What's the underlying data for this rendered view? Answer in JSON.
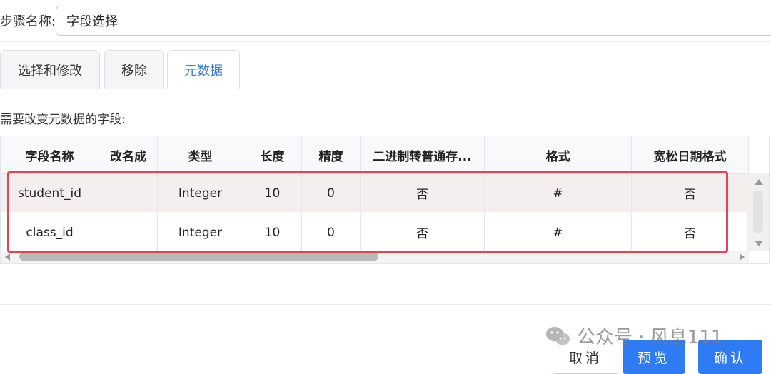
{
  "step": {
    "label": "步骤名称:",
    "value": "字段选择"
  },
  "tabs": [
    {
      "label": "选择和修改",
      "active": false
    },
    {
      "label": "移除",
      "active": false
    },
    {
      "label": "元数据",
      "active": true
    }
  ],
  "section_label": "需要改变元数据的字段:",
  "table": {
    "columns": [
      "字段名称",
      "改名成",
      "类型",
      "长度",
      "精度",
      "二进制转普通存...",
      "格式",
      "宽松日期格式"
    ],
    "rows": [
      [
        "student_id",
        "",
        "Integer",
        "10",
        "0",
        "否",
        "#",
        "否"
      ],
      [
        "class_id",
        "",
        "Integer",
        "10",
        "0",
        "否",
        "#",
        "否"
      ]
    ]
  },
  "buttons": {
    "cancel": "取消",
    "preview": "预览",
    "confirm": "确认"
  },
  "watermark": {
    "text": "公众号 · 风息111",
    "icon": "wechat-icon"
  },
  "colors": {
    "accent": "#2f7bf5",
    "active_tab": "#3a7bd5",
    "highlight": "#e8444f"
  }
}
